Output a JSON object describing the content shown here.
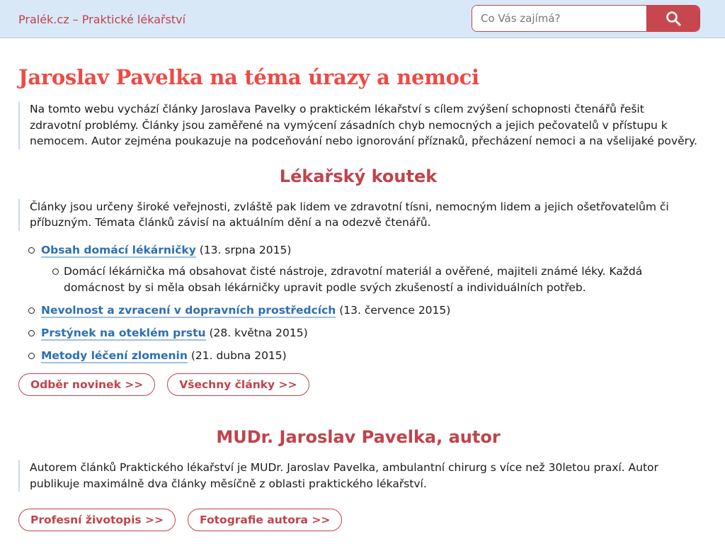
{
  "header": {
    "site_title": "Pralék.cz – Praktické lékařství",
    "search_placeholder": "Co Vás zajímá?"
  },
  "main": {
    "title": "Jaroslav Pavelka na téma úrazy a nemoci",
    "intro": "Na tomto webu vychází články Jaroslava Pavelky o praktickém lékařství s cílem zvýšení schopnosti čtenářů řešit zdravotní problémy. Články jsou zaměřené na vymýcení zásadních chyb nemocných a jejich pečovatelů v přístupu k nemocem. Autor zejména poukazuje na podceňování nebo ignorování příznaků, přecházení nemoci a na všelijaké pověry."
  },
  "corner": {
    "heading": "Lékařský koutek",
    "text": "Články jsou určeny široké veřejnosti, zvláště pak lidem ve zdravotní tísni, nemocným lidem a jejich ošetřovatelům či příbuzným. Témata článků závisí na aktuálním dění a na odezvě čtenářů.",
    "articles": [
      {
        "title": "Obsah domácí lékárničky",
        "date": "(13. srpna 2015)",
        "summary": "Domácí lékárnička má obsahovat čisté nástroje, zdravotní materiál a ověřené, majiteli známé léky. Každá domácnost by si měla obsah lékárničky upravit podle svých zkušeností a individuálních potřeb."
      },
      {
        "title": "Nevolnost a zvracení v dopravních prostředcích",
        "date": "(13. července 2015)"
      },
      {
        "title": "Prstýnek na oteklém prstu",
        "date": "(28. května 2015)"
      },
      {
        "title": "Metody léčení zlomenin",
        "date": "(21. dubna 2015)"
      }
    ],
    "buttons": [
      "Odběr novinek  >>",
      "Všechny články  >>"
    ]
  },
  "author": {
    "heading": "MUDr. Jaroslav Pavelka, autor",
    "text": "Autorem článků Praktického lékařství je MUDr. Jaroslav Pavelka, ambulantní chirurg s více než 30letou praxí. Autor publikuje maximálně dva články měsíčně z oblasti praktického lékařství.",
    "buttons": [
      "Profesní životopis  >>",
      "Fotografie autora  >>"
    ]
  },
  "colors": {
    "accent": "#c0434b",
    "title": "#ee4a44",
    "link": "#2d6fb3",
    "header_bg": "#d8e8f7"
  }
}
